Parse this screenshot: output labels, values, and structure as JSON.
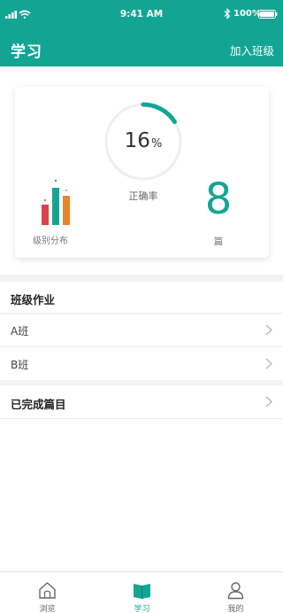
{
  "status_bar": {
    "time": "9:41 AM",
    "battery_percent": "100%"
  },
  "nav": {
    "title": "学习",
    "join_class": "加入班级"
  },
  "stats": {
    "accuracy_value": "16",
    "accuracy_unit": "%",
    "accuracy_fraction": 0.16,
    "accuracy_label": "正确率",
    "level_distribution_label": "级别分布",
    "articles_count": "8",
    "articles_unit": "篇"
  },
  "sections": {
    "class_homework": "班级作业",
    "class_a": "A班",
    "class_b": "B班",
    "completed": "已完成篇目"
  },
  "tabbar": {
    "tabs": [
      {
        "label": "浏览",
        "icon": "home-icon",
        "active": false
      },
      {
        "label": "学习",
        "icon": "book-icon",
        "active": true
      },
      {
        "label": "我的",
        "icon": "user-icon",
        "active": false
      }
    ]
  },
  "colors": {
    "accent": "#12a594",
    "bar_red": "#d9414b",
    "bar_teal": "#12a594",
    "bar_orange": "#e8862a"
  }
}
